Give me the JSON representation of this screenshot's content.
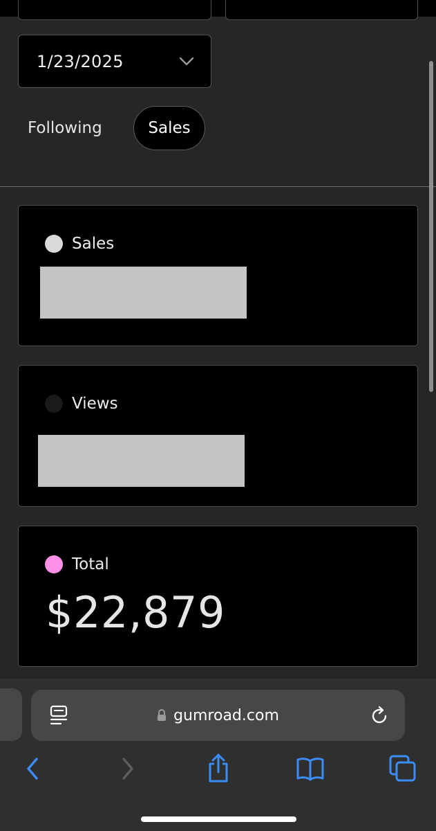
{
  "filters": {
    "date_value": "1/23/2025",
    "tabs": [
      {
        "label": "Following",
        "active": false
      },
      {
        "label": "Sales",
        "active": true
      }
    ]
  },
  "cards": {
    "sales": {
      "label": "Sales",
      "dot_color": "#d9d9d9"
    },
    "views": {
      "label": "Views",
      "dot_color": "#1a1a1a"
    },
    "total": {
      "label": "Total",
      "dot_color": "#ff90e8",
      "value": "$22,879"
    }
  },
  "browser": {
    "url": "gumroad.com",
    "icons": [
      "reader-icon",
      "lock-icon",
      "reload-icon",
      "back-icon",
      "forward-icon",
      "share-icon",
      "bookmarks-icon",
      "tabs-icon"
    ]
  },
  "colors": {
    "accent_blue": "#3b8cf5",
    "page_bg": "#262626",
    "card_bg": "#000000",
    "total_dot": "#ff90e8"
  }
}
